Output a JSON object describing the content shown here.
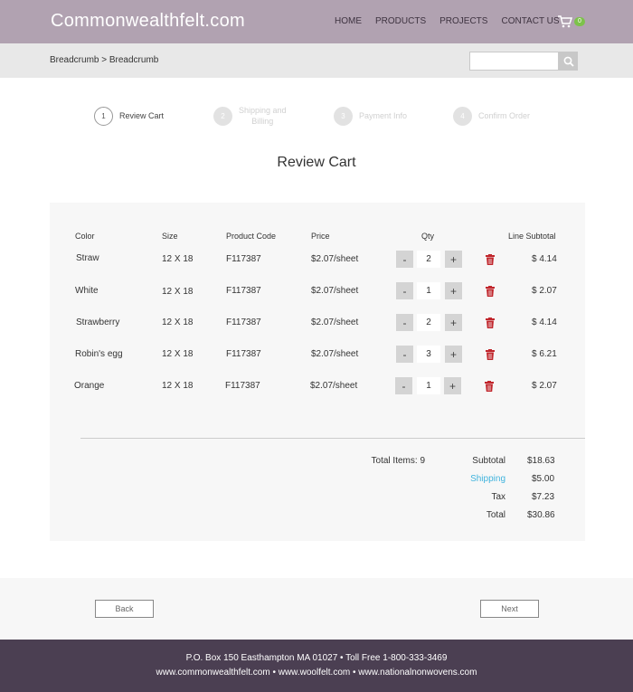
{
  "header": {
    "logo": "Commonwealthfelt.com",
    "nav": [
      "HOME",
      "PRODUCTS",
      "PROJECTS",
      "CONTACT US"
    ],
    "cart_count": "0",
    "colors": {
      "header_bg": "#b1a2b1",
      "badge": "#7dc24b"
    }
  },
  "subbar": {
    "breadcrumb": "Breadcrumb > Breadcrumb",
    "search_value": ""
  },
  "steps": [
    {
      "num": "1",
      "label": "Review Cart",
      "active": true
    },
    {
      "num": "2",
      "label_line1": "Shipping and",
      "label_line2": "Billing",
      "active": false
    },
    {
      "num": "3",
      "label": "Payment Info",
      "active": false
    },
    {
      "num": "4",
      "label": "Confirm Order",
      "active": false
    }
  ],
  "page_title": "Review Cart",
  "table": {
    "headers": [
      "Color",
      "Size",
      "Product Code",
      "Price",
      "Qty",
      "Line Subtotal"
    ],
    "rows": [
      {
        "color": "Straw",
        "size": "12 X 18",
        "code": "F117387",
        "price": "$2.07/sheet",
        "qty": "2",
        "subtotal": "$ 4.14"
      },
      {
        "color": "White",
        "size": "12 X 18",
        "code": "F117387",
        "price": "$2.07/sheet",
        "qty": "1",
        "subtotal": "$ 2.07"
      },
      {
        "color": "Strawberry",
        "size": "12 X 18",
        "code": "F117387",
        "price": "$2.07/sheet",
        "qty": "2",
        "subtotal": "$ 4.14"
      },
      {
        "color": "Robin's egg",
        "size": "12 X 18",
        "code": "F117387",
        "price": "$2.07/sheet",
        "qty": "3",
        "subtotal": "$ 6.21"
      },
      {
        "color": "Orange",
        "size": "12 X 18",
        "code": "F117387",
        "price": "$2.07/sheet",
        "qty": "1",
        "subtotal": "$ 2.07"
      }
    ],
    "minus": "-",
    "plus": "+"
  },
  "summary": {
    "total_items": "Total Items: 9",
    "subtotal_label": "Subtotal",
    "subtotal": "$18.63",
    "shipping_label": "Shipping",
    "shipping": "$5.00",
    "tax_label": "Tax",
    "tax": "$7.23",
    "total_label": "Total",
    "total": "$30.86"
  },
  "buttons": {
    "back": "Back",
    "next": "Next"
  },
  "footer": {
    "line1": "P.O. Box 150 Easthampton MA 01027 • Toll Free 1-800-333-3469",
    "line2": "www.commonwealthfelt.com • www.woolfelt.com • www.nationalnonwovens.com"
  }
}
